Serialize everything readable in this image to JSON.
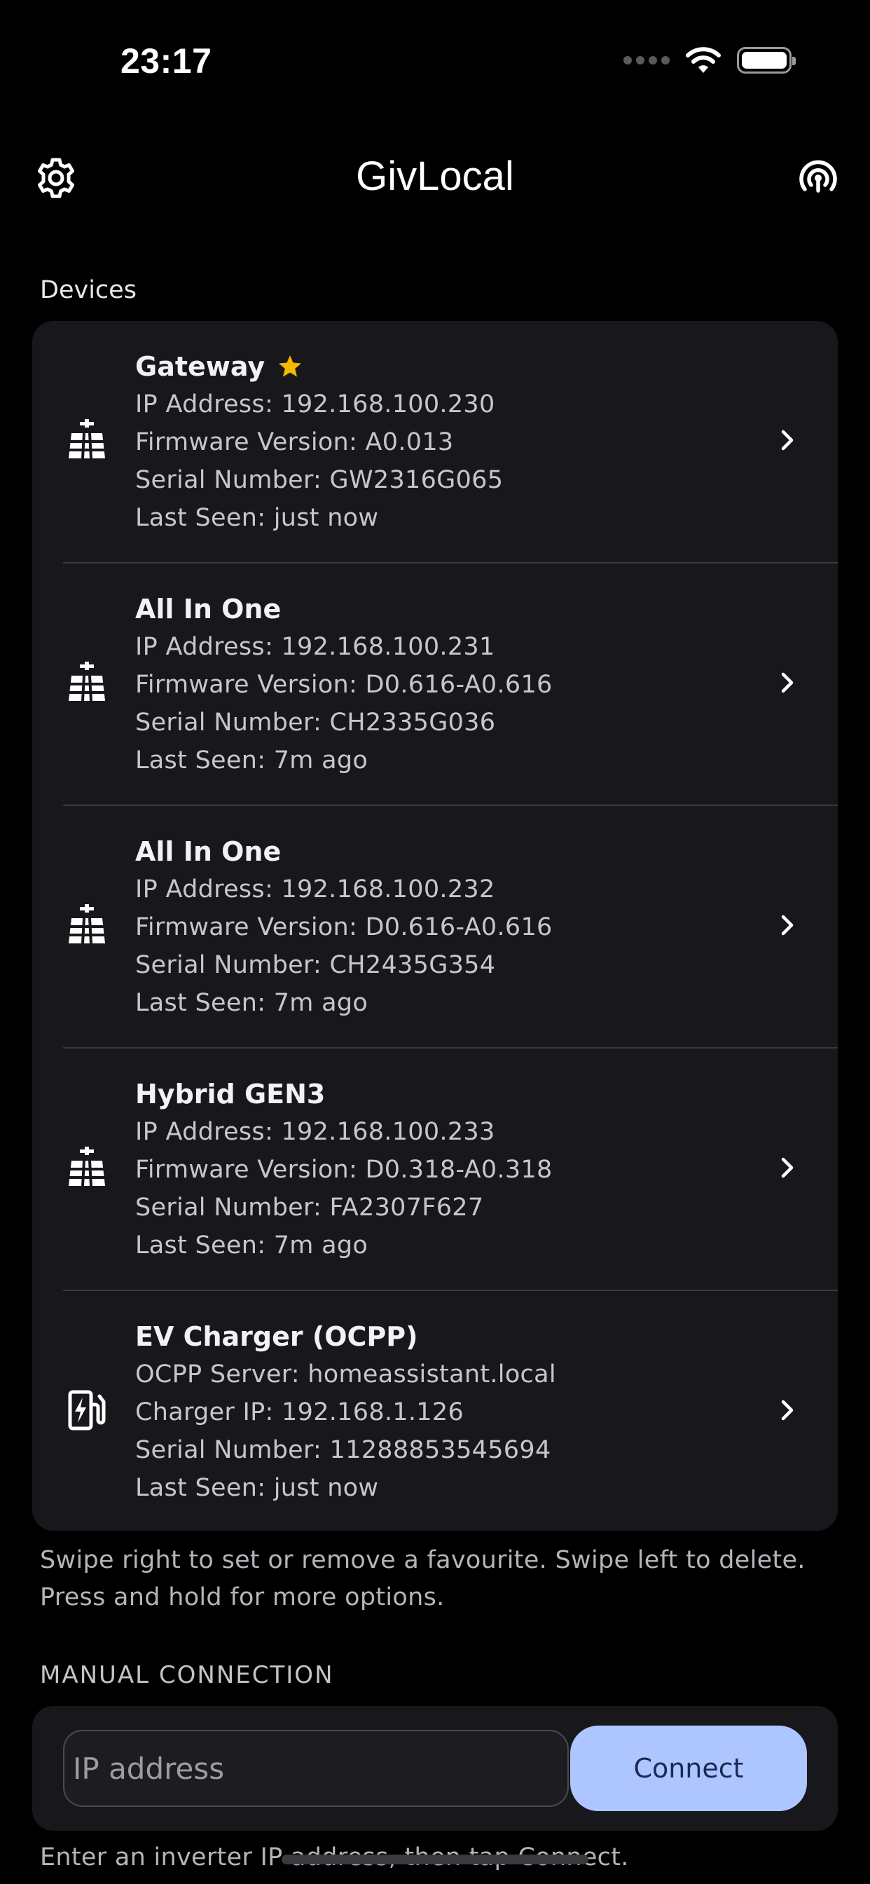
{
  "status_bar": {
    "time": "23:17"
  },
  "header": {
    "title": "GivLocal"
  },
  "devices_section": {
    "label": "Devices"
  },
  "devices": [
    {
      "name": "Gateway",
      "favourite": true,
      "icon": "solar-inverter-icon",
      "lines": [
        "IP Address: 192.168.100.230",
        "Firmware Version: A0.013",
        "Serial Number: GW2316G065",
        "Last Seen: just now"
      ]
    },
    {
      "name": "All In One",
      "favourite": false,
      "icon": "solar-inverter-icon",
      "lines": [
        "IP Address: 192.168.100.231",
        "Firmware Version: D0.616-A0.616",
        "Serial Number: CH2335G036",
        "Last Seen: 7m ago"
      ]
    },
    {
      "name": "All In One",
      "favourite": false,
      "icon": "solar-inverter-icon",
      "lines": [
        "IP Address: 192.168.100.232",
        "Firmware Version: D0.616-A0.616",
        "Serial Number: CH2435G354",
        "Last Seen: 7m ago"
      ]
    },
    {
      "name": "Hybrid GEN3",
      "favourite": false,
      "icon": "solar-inverter-icon",
      "lines": [
        "IP Address: 192.168.100.233",
        "Firmware Version: D0.318-A0.318",
        "Serial Number: FA2307F627",
        "Last Seen: 7m ago"
      ]
    },
    {
      "name": "EV Charger (OCPP)",
      "favourite": false,
      "icon": "ev-charger-icon",
      "lines": [
        "OCPP Server: homeassistant.local",
        "Charger IP: 192.168.1.126",
        "Serial Number: 11288853545694",
        "Last Seen: just now"
      ]
    }
  ],
  "hint": "Swipe right to set or remove a favourite. Swipe left to delete. Press and hold for more options.",
  "manual": {
    "label": "MANUAL CONNECTION",
    "placeholder": "IP address",
    "value": "",
    "connect_label": "Connect",
    "footer": "Enter an inverter IP address, then tap Connect."
  },
  "colors": {
    "accent": "#aec6ff",
    "star": "#f5b800",
    "card": "#18181c",
    "background": "#000000"
  }
}
